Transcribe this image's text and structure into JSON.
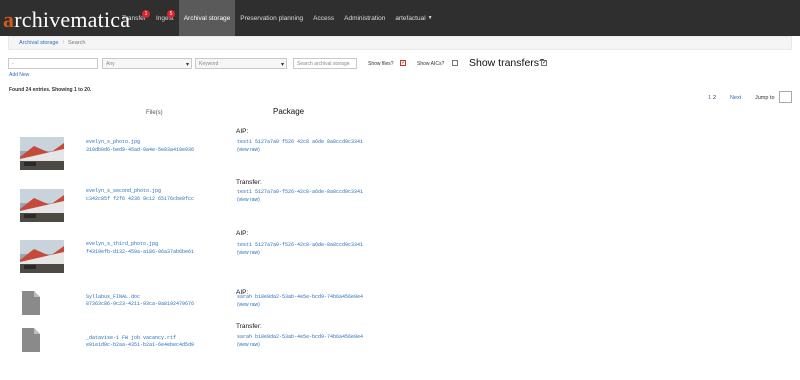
{
  "app": {
    "logo_text": "archivematica"
  },
  "nav": {
    "items": [
      {
        "label": "Transfer",
        "badge": "1"
      },
      {
        "label": "Ingest",
        "badge": "5"
      },
      {
        "label": "Archival storage"
      },
      {
        "label": "Preservation planning"
      },
      {
        "label": "Access"
      },
      {
        "label": "Administration"
      },
      {
        "label": "artefactual"
      }
    ]
  },
  "breadcrumb": {
    "root": "Archival storage",
    "current": "Search"
  },
  "search": {
    "field_value": "-",
    "type_select": "Any",
    "keyword_select": "Keyword",
    "search_placeholder": "Search archival storage",
    "add_new": "Add New",
    "show_files_label": "Show files?",
    "show_aics_label": "Show AICs?",
    "show_transfers_label": "Show transfers?"
  },
  "results": {
    "summary": "Found 24 entries. Showing 1 to 20.",
    "pager": {
      "page1": "1",
      "page2": "2",
      "next": "Next",
      "jump_label": "Jump to"
    },
    "columns": {
      "files": "File(s)",
      "package": "Package"
    },
    "rows": [
      {
        "thumb": "photo",
        "name": "evelyn_s_photo.jpg",
        "uuid": "319db0d6-bed9-45ad-9a4e-5e83a419e936",
        "pkg_type": "AIP:",
        "pkg_name": "test1 5127a7a0 f526 42c8 a6de 8a8ccd9c3341",
        "view": "(view raw)"
      },
      {
        "thumb": "photo",
        "name": "evelyn_s_second_photo.jpg",
        "uuid": "c342c85f f2f6 4236 9c12 65176cbe0fcc",
        "pkg_type": "Transfer:",
        "pkg_name": "test1 5127a7a0-f526-42c8-a6de-8a8ccd9c3341",
        "view": "(view raw)"
      },
      {
        "thumb": "photo",
        "name": "evelyn_s_third_photo.jpg",
        "uuid": "f4319efb-d132-459a-a186-06a37ab6be61",
        "pkg_type": "AIP:",
        "pkg_name": "test1 5127a7a0-f526-42c8-a6de-8a8ccd9c3341",
        "view": "(view raw)"
      },
      {
        "thumb": "doc",
        "name": "Syllabus_FINAL.doc",
        "uuid": "87363c86-9c23-4211-93ca-0a8192479676",
        "pkg_type": "AIP:",
        "pkg_name": "sarah b18e0da2-53ab-4e5e-bcd9-74b6a456e9e4",
        "view": "(view raw)"
      },
      {
        "thumb": "doc",
        "name": "_datavise-1 FW job vacancy.rtf",
        "uuid": "e91e1d0c-b2aa-4351-b2a1-6e4ebec4d5d9",
        "pkg_type": "Transfer:",
        "pkg_name": "sarah b18e0da2-53ab-4e5e-bcd9-74b6a456e9e4",
        "view": "(view raw)"
      }
    ]
  }
}
